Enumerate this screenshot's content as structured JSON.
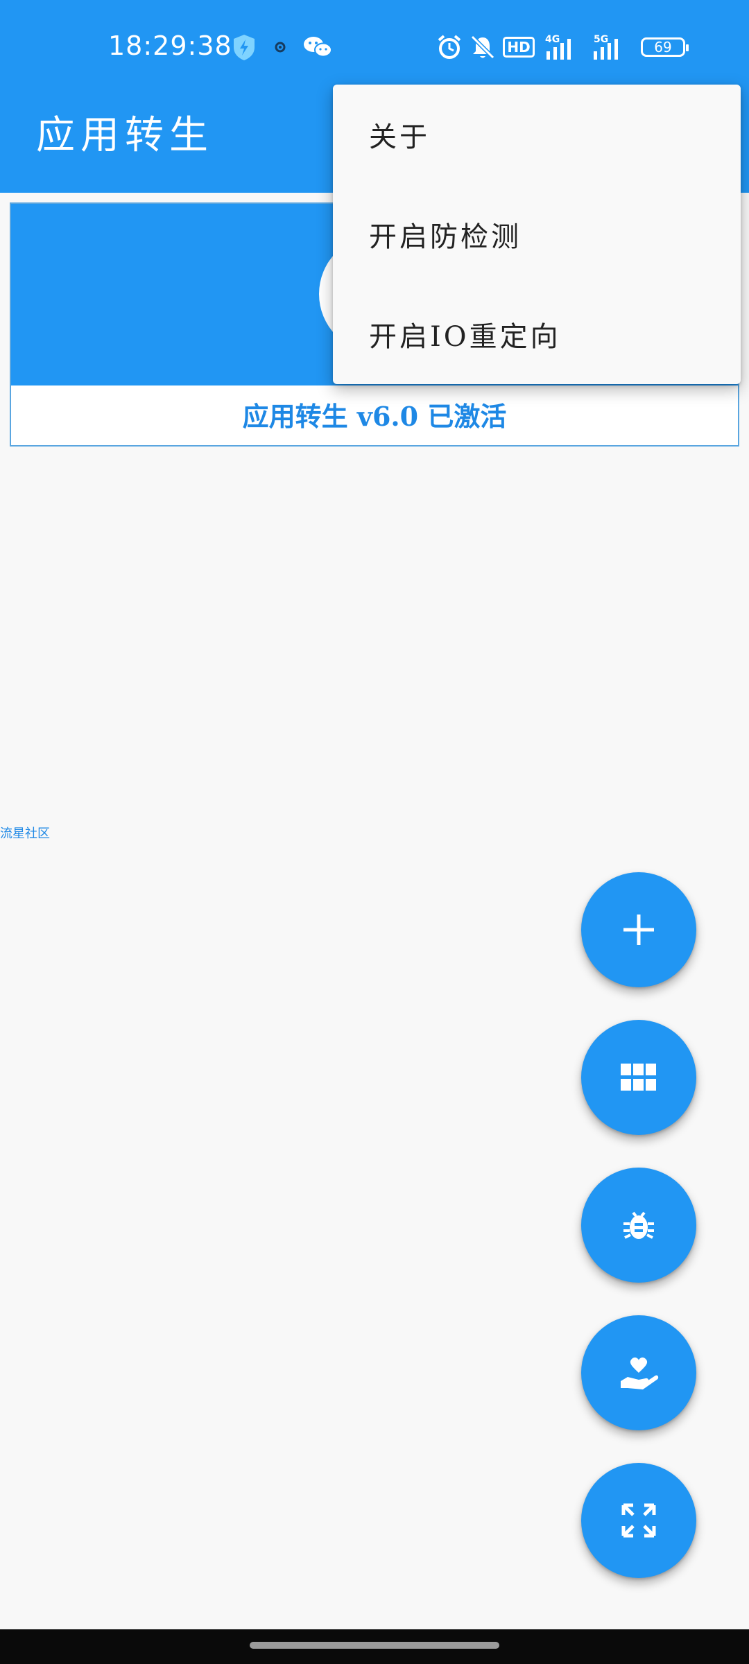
{
  "status_bar": {
    "time": "18:29:38",
    "network_1": "4G",
    "network_2": "5G",
    "hd_label": "HD",
    "battery": "69"
  },
  "app_bar": {
    "title": "应用转生"
  },
  "banner": {
    "status_text": "应用转生 v6.0 已激活"
  },
  "menu": {
    "items": [
      {
        "label": "关于"
      },
      {
        "label": "开启防检测"
      },
      {
        "label": "开启IO重定向"
      }
    ]
  },
  "side_link": {
    "text": "流星社区"
  },
  "fabs": [
    {
      "icon": "plus-icon"
    },
    {
      "icon": "grid-icon"
    },
    {
      "icon": "bug-icon"
    },
    {
      "icon": "donate-heart-icon"
    },
    {
      "icon": "expand-icon"
    }
  ],
  "colors": {
    "primary": "#2196f3",
    "accent_text": "#1e88e5",
    "background": "#f8f8f8"
  }
}
